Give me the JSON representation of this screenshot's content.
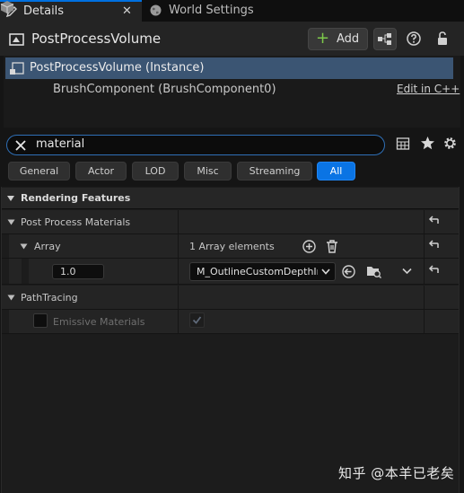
{
  "tabs": [
    {
      "label": "Details",
      "close": "✕"
    },
    {
      "label": "World Settings"
    }
  ],
  "header": {
    "actor_name": "PostProcessVolume",
    "add_label": "Add"
  },
  "components": {
    "root": "PostProcessVolume (Instance)",
    "child": "BrushComponent (BrushComponent0)",
    "edit_link": "Edit in C++"
  },
  "search": {
    "value": "material"
  },
  "filters": [
    "General",
    "Actor",
    "LOD",
    "Misc",
    "Streaming",
    "All"
  ],
  "active_filter": "All",
  "properties": {
    "category": "Rendering Features",
    "post_process_materials": "Post Process Materials",
    "array_label": "Array",
    "array_count": "1 Array elements",
    "element_weight": "1.0",
    "element_asset": "M_OutlineCustomDepthIn",
    "path_tracing": "PathTracing",
    "emissive_materials": "Emissive Materials"
  },
  "watermark": "知乎 @本羊已老矣",
  "colors": {
    "accent": "#0a74e4",
    "selection": "#3b5573",
    "add_plus": "#7dc94a"
  }
}
